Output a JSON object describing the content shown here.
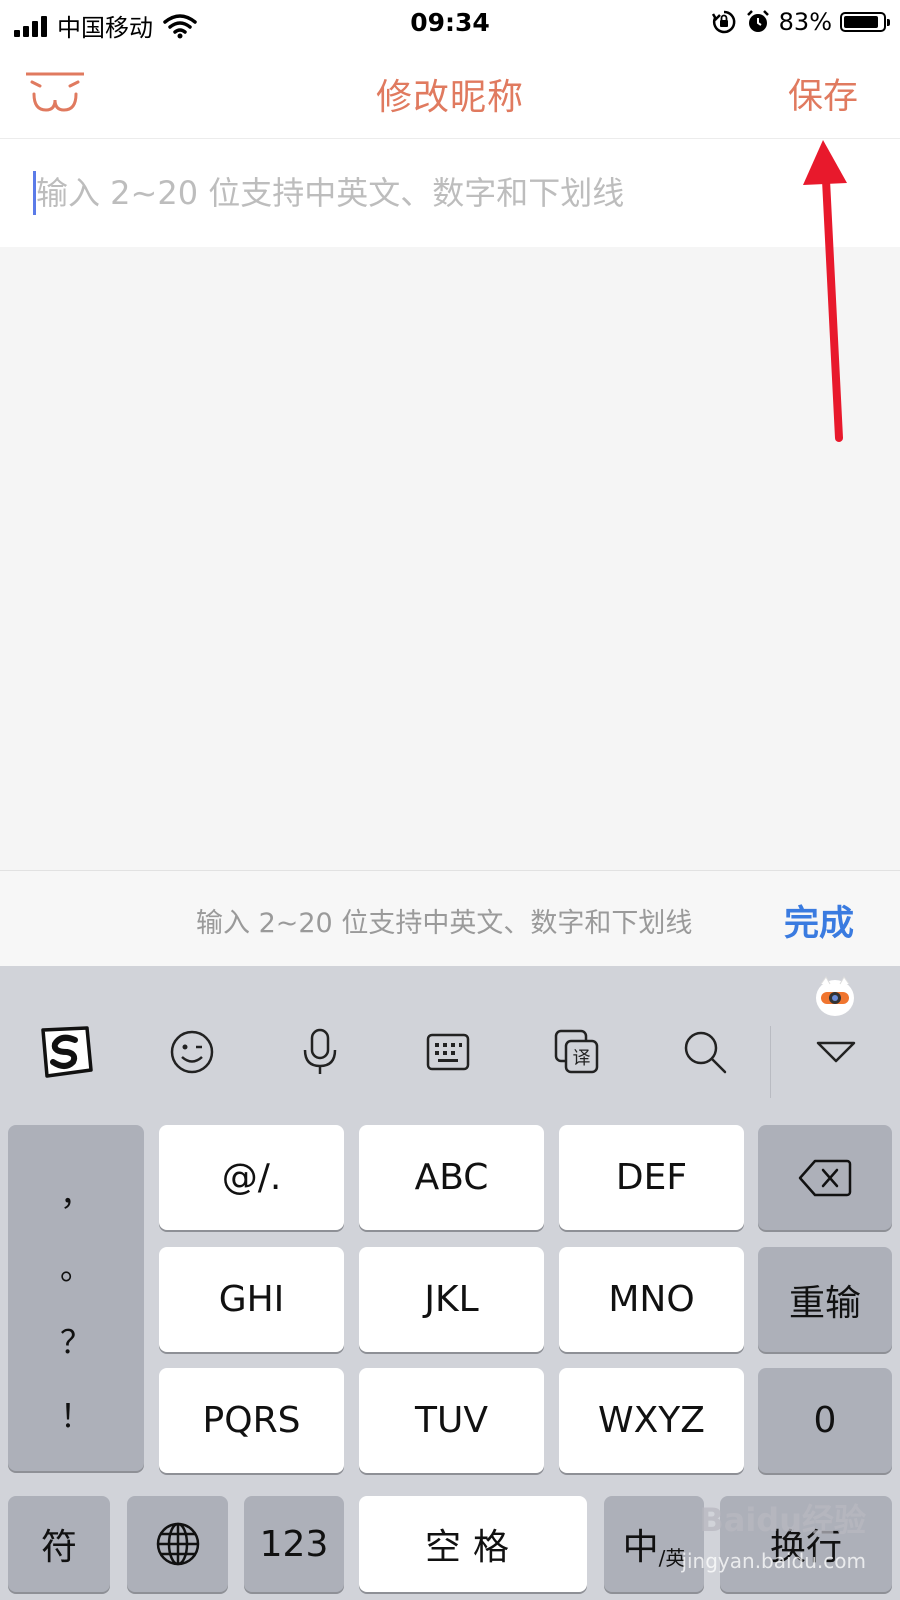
{
  "status_bar": {
    "carrier": "中国移动",
    "time": "09:34",
    "battery": "83%",
    "battery_level": 0.83
  },
  "nav": {
    "title": "修改昵称",
    "save": "保存"
  },
  "nickname_input": {
    "value": "",
    "placeholder": "输入 2~20 位支持中英文、数字和下划线"
  },
  "accessory_bar": {
    "hint": "输入 2~20 位支持中英文、数字和下划线",
    "done": "完成"
  },
  "keyboard": {
    "punct_keys": [
      "，",
      "。",
      "？",
      "！"
    ],
    "rows": [
      [
        "@/.",
        "ABC",
        "DEF"
      ],
      [
        "GHI",
        "JKL",
        "MNO"
      ],
      [
        "PQRS",
        "TUV",
        "WXYZ"
      ]
    ],
    "reinput": "重输",
    "zero": "0",
    "fu": "符",
    "num": "123",
    "space": "空格",
    "lang_main": "中",
    "lang_sub": "/英",
    "enter": "换行"
  },
  "toolbar_icons": [
    "sogou-logo-icon",
    "emoji-icon",
    "microphone-icon",
    "keyboard-icon",
    "translate-icon",
    "search-icon",
    "collapse-keyboard-icon"
  ],
  "watermark": {
    "logo": "Baidu经验",
    "url": "jingyan.baidu.com"
  },
  "colors": {
    "accent": "#e07a5f",
    "done_blue": "#3a7be0",
    "annotation_arrow": "#e8192c",
    "caret": "#5b7be8"
  }
}
